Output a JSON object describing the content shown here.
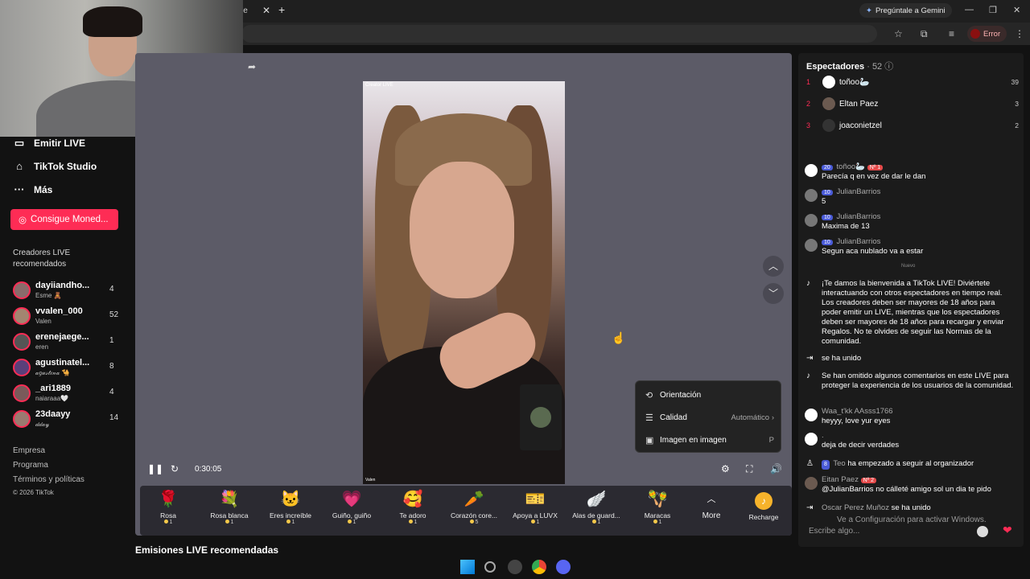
{
  "browser": {
    "tab_title": "le",
    "gemini_label": "Pregúntale a Gemini",
    "error_label": "Error"
  },
  "sidebar": {
    "nav": [
      {
        "label": "Emitir LIVE",
        "icon": "video-camera-icon"
      },
      {
        "label": "TikTok Studio",
        "icon": "home-icon"
      },
      {
        "label": "Más",
        "icon": "more-dots-icon"
      }
    ],
    "coins_button": "Consigue Moned...",
    "section_title": "Creadores LIVE recomendados",
    "creators": [
      {
        "name": "dayiiandho...",
        "sub": "Esme 🧸",
        "count": "4"
      },
      {
        "name": "vvalen_000",
        "sub": "Valen",
        "count": "52"
      },
      {
        "name": "erenejaege...",
        "sub": "eren",
        "count": "1"
      },
      {
        "name": "agustinatel...",
        "sub": "𝒶𝑔𝓊𝓈𝓉𝒾𝓃𝒶 🐪",
        "count": "8"
      },
      {
        "name": "_ari1889",
        "sub": "naiaraaa🤍",
        "count": "4"
      },
      {
        "name": "23daayy",
        "sub": "𝒹𝒹𝒶𝓎",
        "count": "14"
      }
    ],
    "footer": [
      "Empresa",
      "Programa",
      "Términos y políticas",
      "© 2026 TikTok"
    ]
  },
  "player": {
    "time": "0:30:05",
    "video_brand": "Creator LIVE",
    "video_streamer": "Valen",
    "menu": {
      "orientation": "Orientación",
      "quality": "Calidad",
      "quality_value": "Automático",
      "pip": "Imagen en imagen",
      "pip_key": "P"
    }
  },
  "gifts": [
    {
      "name": "Rosa",
      "price": "1",
      "icon": "🌹"
    },
    {
      "name": "Rosa blanca",
      "price": "1",
      "icon": "💐"
    },
    {
      "name": "Eres increíble",
      "price": "1",
      "icon": "🐱"
    },
    {
      "name": "Guiño, guiño",
      "price": "1",
      "icon": "💗"
    },
    {
      "name": "Te adoro",
      "price": "1",
      "icon": "🥰"
    },
    {
      "name": "Corazón core...",
      "price": "5",
      "icon": "🥕"
    },
    {
      "name": "Apoya a LUVX",
      "price": "1",
      "icon": "🎫"
    },
    {
      "name": "Alas de guard...",
      "price": "1",
      "icon": "🪽"
    },
    {
      "name": "Maracas",
      "price": "1",
      "icon": "🪇"
    }
  ],
  "more_label": "More",
  "recharge_label": "Recharge",
  "recommended_title": "Emisiones LIVE recomendadas",
  "chat": {
    "viewers_label": "Espectadores",
    "viewers_count": "· 52",
    "top": [
      {
        "rank": "1",
        "name": "toñoo🦢",
        "score": "39"
      },
      {
        "rank": "2",
        "name": "Eltan Paez",
        "score": "3"
      },
      {
        "rank": "3",
        "name": "joaconietzel",
        "score": "2"
      }
    ],
    "messages": [
      {
        "level": "20",
        "name": "toñoo🦢",
        "rank_badge": "Nº 1",
        "text": "Parecía q en vez de dar le dan"
      },
      {
        "level": "10",
        "name": "JulianBarrios",
        "text": "5"
      },
      {
        "level": "10",
        "name": "JulianBarrios",
        "text": "Maxima de 13"
      },
      {
        "level": "10",
        "name": "JulianBarrios",
        "text": "Segun aca nublado va a estar"
      }
    ],
    "nuevo": "Nuevo",
    "welcome": "¡Te damos la bienvenida a TikTok LIVE! Diviértete interactuando con otros espectadores en tiempo real. Los creadores deben ser mayores de 18 años para poder emitir un LIVE, mientras que los espectadores deben ser mayores de 18 años para recargar y enviar Regalos. No te olvides de seguir las Normas de la comunidad.",
    "joined": "se ha unido",
    "omitted": "Se han omitido algunos comentarios en este LIVE para proteger la experiencia de los usuarios de la comunidad.",
    "msg2_name": "Waa_t'kk AAsss1766",
    "msg2_text": "heyyy, love yur eyes",
    "msg3_name": ".",
    "msg3_text": "deja de decir verdades",
    "follow_level": "8",
    "follow_name": "Teo",
    "follow_text": "ha empezado a seguir al organizador",
    "msg4_name": "Eitan Paez",
    "msg4_badge": "Nº 2",
    "msg4_text": "@JulianBarrios no cálleté amigo sol un dia te pido",
    "last_name": "Oscar Perez Muñoz",
    "last_text": "se ha unido",
    "input_placeholder": "Escribe algo...",
    "windows_notice": "Ve a Configuración para activar Windows."
  }
}
